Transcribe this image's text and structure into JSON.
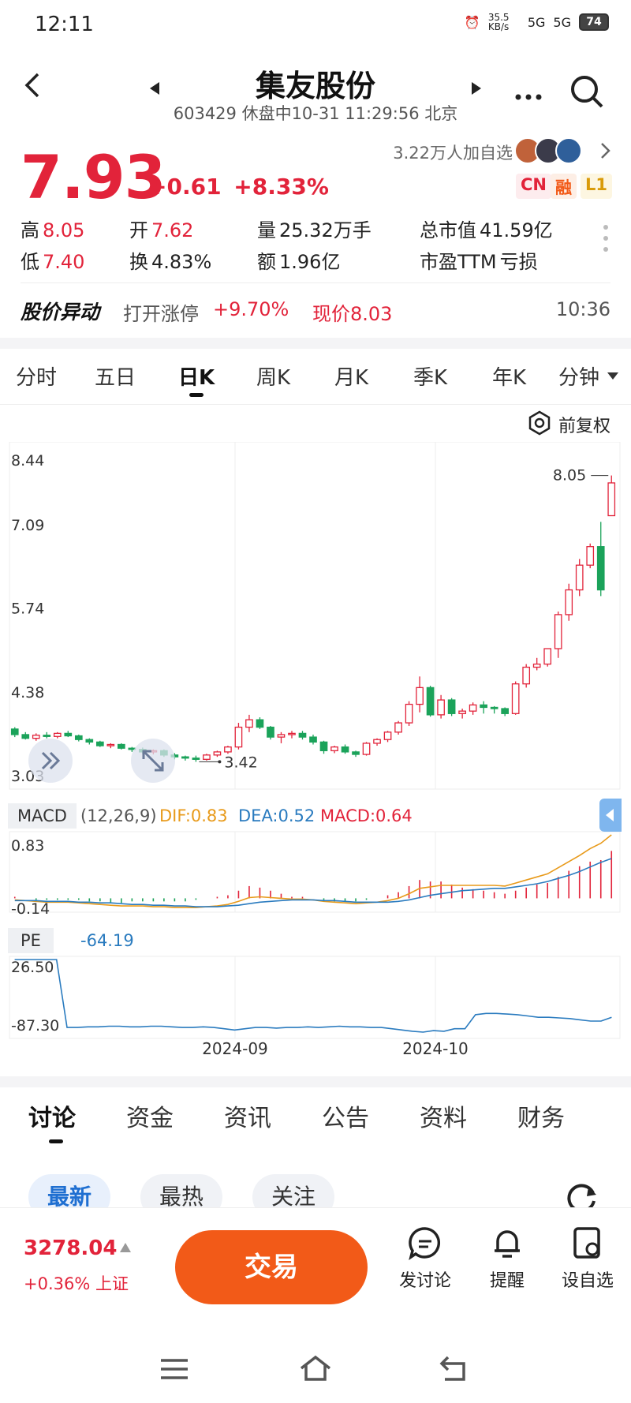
{
  "status_bar": {
    "time": "12:11",
    "net_speed": "35.5 KB/s",
    "signal1": "5G",
    "signal2": "5G",
    "battery": "74"
  },
  "header": {
    "stock_name": "集友股份",
    "subtitle": "603429 休盘中10-31 11:29:56 北京"
  },
  "quote": {
    "price": "7.93",
    "change": "+0.61",
    "change_pct": "+8.33%",
    "watchers": "3.22万人加自选",
    "tags": [
      "CN",
      "融",
      "L1"
    ]
  },
  "stats": {
    "high_label": "高",
    "high": "8.05",
    "low_label": "低",
    "low": "7.40",
    "open_label": "开",
    "open": "7.62",
    "turnover_label": "换",
    "turnover": "4.83%",
    "volume_label": "量",
    "volume": "25.32万手",
    "amount_label": "额",
    "amount": "1.96亿",
    "mcap_label": "总市值",
    "mcap": "41.59亿",
    "pe_label": "市盈TTM",
    "pe": "亏损"
  },
  "alert": {
    "title": "股价异动",
    "desc": "打开涨停",
    "pct": "+9.70%",
    "now": "现价8.03",
    "time": "10:36"
  },
  "chart_tabs": [
    "分时",
    "五日",
    "日K",
    "周K",
    "月K",
    "季K",
    "年K",
    "分钟"
  ],
  "active_chart_tab": "日K",
  "adjust_label": "前复权",
  "chart_data": {
    "type": "candlestick",
    "title": "",
    "ylim": [
      3.03,
      8.44
    ],
    "y_ticks": [
      "8.44",
      "7.09",
      "5.74",
      "4.38",
      "3.03"
    ],
    "x_ticks": [
      "2024-09",
      "2024-10"
    ],
    "annotations": {
      "max": "8.05",
      "min": "3.42"
    },
    "candles": [
      [
        3.95,
        3.98,
        3.82,
        3.86
      ],
      [
        3.86,
        3.9,
        3.78,
        3.8
      ],
      [
        3.8,
        3.88,
        3.76,
        3.85
      ],
      [
        3.85,
        3.9,
        3.8,
        3.83
      ],
      [
        3.83,
        3.9,
        3.8,
        3.88
      ],
      [
        3.88,
        3.92,
        3.82,
        3.84
      ],
      [
        3.84,
        3.86,
        3.75,
        3.78
      ],
      [
        3.78,
        3.8,
        3.7,
        3.74
      ],
      [
        3.74,
        3.76,
        3.66,
        3.68
      ],
      [
        3.68,
        3.72,
        3.64,
        3.7
      ],
      [
        3.7,
        3.72,
        3.62,
        3.64
      ],
      [
        3.64,
        3.66,
        3.58,
        3.62
      ],
      [
        3.62,
        3.65,
        3.55,
        3.58
      ],
      [
        3.58,
        3.62,
        3.54,
        3.6
      ],
      [
        3.6,
        3.62,
        3.5,
        3.53
      ],
      [
        3.53,
        3.56,
        3.46,
        3.5
      ],
      [
        3.5,
        3.52,
        3.44,
        3.48
      ],
      [
        3.48,
        3.52,
        3.42,
        3.46
      ],
      [
        3.46,
        3.55,
        3.44,
        3.53
      ],
      [
        3.53,
        3.6,
        3.5,
        3.58
      ],
      [
        3.58,
        3.68,
        3.55,
        3.66
      ],
      [
        3.66,
        4.05,
        3.62,
        3.98
      ],
      [
        3.98,
        4.18,
        3.9,
        4.1
      ],
      [
        4.1,
        4.14,
        3.95,
        3.98
      ],
      [
        3.98,
        4.0,
        3.78,
        3.82
      ],
      [
        3.82,
        3.9,
        3.72,
        3.86
      ],
      [
        3.86,
        3.92,
        3.8,
        3.88
      ],
      [
        3.88,
        3.92,
        3.78,
        3.82
      ],
      [
        3.82,
        3.86,
        3.7,
        3.74
      ],
      [
        3.74,
        3.76,
        3.55,
        3.6
      ],
      [
        3.6,
        3.68,
        3.56,
        3.66
      ],
      [
        3.66,
        3.7,
        3.55,
        3.58
      ],
      [
        3.58,
        3.6,
        3.5,
        3.54
      ],
      [
        3.54,
        3.74,
        3.52,
        3.72
      ],
      [
        3.72,
        3.8,
        3.68,
        3.78
      ],
      [
        3.78,
        3.92,
        3.74,
        3.9
      ],
      [
        3.9,
        4.08,
        3.86,
        4.05
      ],
      [
        4.05,
        4.4,
        4.0,
        4.35
      ],
      [
        4.35,
        4.8,
        4.22,
        4.62
      ],
      [
        4.62,
        4.65,
        4.15,
        4.18
      ],
      [
        4.18,
        4.5,
        4.12,
        4.42
      ],
      [
        4.42,
        4.45,
        4.16,
        4.2
      ],
      [
        4.2,
        4.28,
        4.12,
        4.24
      ],
      [
        4.24,
        4.38,
        4.18,
        4.34
      ],
      [
        4.34,
        4.4,
        4.2,
        4.3
      ],
      [
        4.3,
        4.32,
        4.2,
        4.28
      ],
      [
        4.28,
        4.3,
        4.16,
        4.2
      ],
      [
        4.2,
        4.72,
        4.18,
        4.68
      ],
      [
        4.68,
        5.0,
        4.62,
        4.95
      ],
      [
        4.95,
        5.1,
        4.9,
        5.0
      ],
      [
        5.0,
        5.2,
        4.96,
        5.25
      ],
      [
        5.25,
        5.85,
        5.1,
        5.8
      ],
      [
        5.8,
        6.3,
        5.7,
        6.2
      ],
      [
        6.2,
        6.7,
        6.1,
        6.6
      ],
      [
        6.6,
        6.95,
        6.55,
        6.9
      ],
      [
        6.9,
        7.3,
        6.1,
        6.2
      ],
      [
        7.4,
        8.05,
        7.4,
        7.93
      ]
    ],
    "series_note": ""
  },
  "macd": {
    "label": "MACD",
    "params": "(12,26,9)",
    "dif": "DIF:0.83",
    "dea": "DEA:0.52",
    "macd": "MACD:0.64",
    "y_top": "0.83",
    "y_bottom": "-0.14",
    "ylim": [
      -0.14,
      0.83
    ],
    "dif_values": [
      -0.02,
      -0.03,
      -0.04,
      -0.05,
      -0.05,
      -0.05,
      -0.06,
      -0.07,
      -0.08,
      -0.09,
      -0.1,
      -0.1,
      -0.1,
      -0.11,
      -0.11,
      -0.12,
      -0.12,
      -0.12,
      -0.11,
      -0.1,
      -0.08,
      -0.04,
      0.01,
      0.02,
      0.01,
      0.0,
      -0.01,
      -0.01,
      -0.02,
      -0.04,
      -0.05,
      -0.06,
      -0.07,
      -0.06,
      -0.05,
      -0.03,
      0.0,
      0.06,
      0.13,
      0.15,
      0.17,
      0.17,
      0.17,
      0.17,
      0.17,
      0.17,
      0.16,
      0.2,
      0.24,
      0.28,
      0.32,
      0.4,
      0.48,
      0.56,
      0.65,
      0.72,
      0.83
    ],
    "dea_values": [
      -0.03,
      -0.03,
      -0.03,
      -0.04,
      -0.04,
      -0.04,
      -0.05,
      -0.05,
      -0.06,
      -0.06,
      -0.07,
      -0.08,
      -0.08,
      -0.09,
      -0.09,
      -0.1,
      -0.1,
      -0.11,
      -0.11,
      -0.11,
      -0.1,
      -0.09,
      -0.07,
      -0.05,
      -0.04,
      -0.03,
      -0.02,
      -0.02,
      -0.02,
      -0.03,
      -0.03,
      -0.04,
      -0.05,
      -0.05,
      -0.05,
      -0.05,
      -0.04,
      -0.02,
      0.01,
      0.04,
      0.06,
      0.08,
      0.1,
      0.11,
      0.12,
      0.13,
      0.13,
      0.15,
      0.17,
      0.19,
      0.22,
      0.26,
      0.3,
      0.35,
      0.41,
      0.47,
      0.52
    ]
  },
  "pe_panel": {
    "label": "PE",
    "value": "-64.19",
    "y_top": "26.50",
    "y_bottom": "-87.30",
    "ylim": [
      -87.3,
      26.5
    ],
    "values": [
      26.5,
      26.5,
      26.5,
      26.5,
      26.5,
      -80,
      -80,
      -79,
      -79,
      -78,
      -78,
      -79,
      -79,
      -78,
      -78,
      -79,
      -80,
      -80,
      -79,
      -80,
      -82,
      -84,
      -82,
      -80,
      -80,
      -81,
      -80,
      -80,
      -79,
      -80,
      -79,
      -78,
      -79,
      -79,
      -80,
      -80,
      -82,
      -84,
      -86,
      -87.3,
      -85,
      -86,
      -82,
      -82,
      -60,
      -58,
      -58,
      -59,
      -60,
      -62,
      -64,
      -64,
      -65,
      -66,
      -68,
      -70,
      -70,
      -64.19
    ]
  },
  "info_tabs": [
    "讨论",
    "资金",
    "资讯",
    "公告",
    "资料",
    "财务"
  ],
  "active_info_tab": "讨论",
  "filter_pills": [
    "最新",
    "最热",
    "关注"
  ],
  "active_pill": "最新",
  "bottom_bar": {
    "index_value": "3278.04",
    "index_change": "+0.36% 上证",
    "trade_label": "交易",
    "items": [
      "发讨论",
      "提醒",
      "设自选"
    ]
  },
  "colors": {
    "up": "#e2233a",
    "down": "#1ba35a",
    "accent": "#f25a18",
    "dif": "#e89a1a",
    "dea": "#2a7bbf",
    "pe": "#2a7bbf"
  }
}
